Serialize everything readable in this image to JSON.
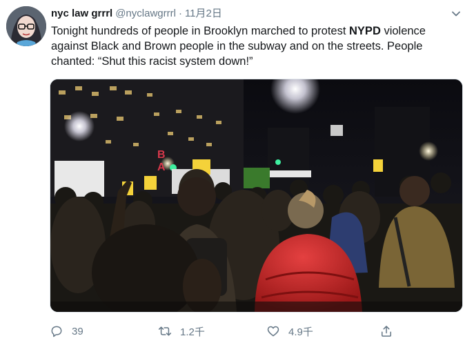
{
  "tweet": {
    "author": {
      "name": "nyc law grrrl",
      "handle": "@nyclawgrrrl",
      "separator": "·",
      "date": "11月2日"
    },
    "text_before": "Tonight hundreds of people in Brooklyn marched to protest ",
    "text_bold": "NYPD",
    "text_after": " violence against Black and Brown people in the subway and on the streets. People chanted: “Shut this racist system down!”",
    "media": {
      "signs": [
        "B",
        "A"
      ]
    },
    "actions": {
      "reply_count": "39",
      "retweet_count": "1.2千",
      "like_count": "4.9千"
    },
    "colors": {
      "text": "#14171a",
      "secondary": "#657786",
      "border": "#e1e8ed"
    },
    "icons": [
      "chevron-down-icon",
      "reply-icon",
      "retweet-icon",
      "like-icon",
      "share-icon"
    ]
  }
}
